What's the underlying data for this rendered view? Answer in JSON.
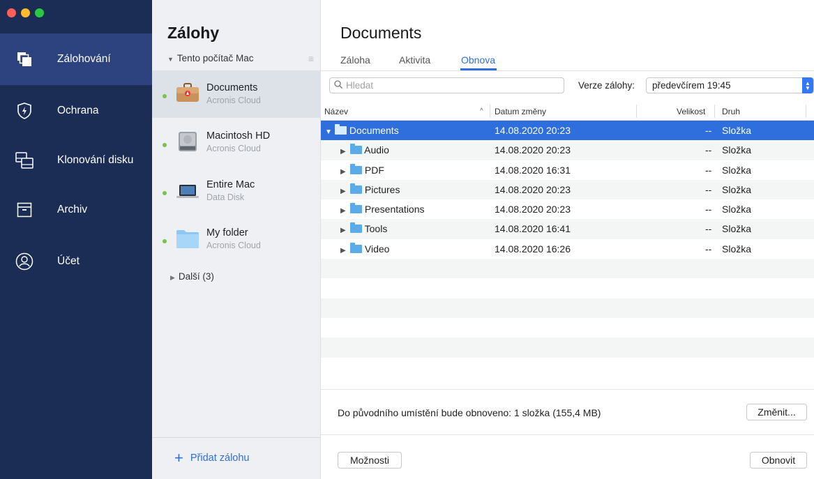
{
  "nav": {
    "items": [
      {
        "label": "Zálohování",
        "icon": "backup-icon",
        "active": true
      },
      {
        "label": "Ochrana",
        "icon": "shield-icon",
        "active": false
      },
      {
        "label": "Klonování disku",
        "icon": "clone-disk-icon",
        "active": false
      },
      {
        "label": "Archiv",
        "icon": "archive-icon",
        "active": false
      },
      {
        "label": "Účet",
        "icon": "account-icon",
        "active": false
      }
    ]
  },
  "backups": {
    "title": "Zálohy",
    "group": "Tento počítač Mac",
    "items": [
      {
        "name": "Documents",
        "location": "Acronis Cloud",
        "icon": "briefcase-icon",
        "status_color": "#7cc14a"
      },
      {
        "name": "Macintosh HD",
        "location": "Acronis Cloud",
        "icon": "hard-drive-icon",
        "status_color": "#7cc14a"
      },
      {
        "name": "Entire Mac",
        "location": "Data Disk",
        "icon": "laptop-icon",
        "status_color": "#7cc14a"
      },
      {
        "name": "My folder",
        "location": "Acronis Cloud",
        "icon": "folder-icon",
        "status_color": "#7cc14a"
      }
    ],
    "more": "Další (3)",
    "add_label": "Přidat zálohu"
  },
  "main": {
    "title": "Documents",
    "tabs": [
      {
        "label": "Záloha",
        "active": false
      },
      {
        "label": "Aktivita",
        "active": false
      },
      {
        "label": "Obnova",
        "active": true
      }
    ],
    "search_placeholder": "Hledat",
    "version_label": "Verze zálohy:",
    "version_value": "předevčírem 19:45",
    "columns": {
      "name": "Název",
      "date": "Datum změny",
      "size": "Velikost",
      "kind": "Druh"
    },
    "rows": [
      {
        "name": "Documents",
        "date": "14.08.2020 20:23",
        "size": "--",
        "kind": "Složka",
        "expanded": true,
        "selected": true,
        "level": 0
      },
      {
        "name": "Audio",
        "date": "14.08.2020 20:23",
        "size": "--",
        "kind": "Složka",
        "expanded": false,
        "selected": false,
        "level": 1
      },
      {
        "name": "PDF",
        "date": "14.08.2020 16:31",
        "size": "--",
        "kind": "Složka",
        "expanded": false,
        "selected": false,
        "level": 1
      },
      {
        "name": "Pictures",
        "date": "14.08.2020 20:23",
        "size": "--",
        "kind": "Složka",
        "expanded": false,
        "selected": false,
        "level": 1
      },
      {
        "name": "Presentations",
        "date": "14.08.2020 20:23",
        "size": "--",
        "kind": "Složka",
        "expanded": false,
        "selected": false,
        "level": 1
      },
      {
        "name": "Tools",
        "date": "14.08.2020 16:41",
        "size": "--",
        "kind": "Složka",
        "expanded": false,
        "selected": false,
        "level": 1
      },
      {
        "name": "Video",
        "date": "14.08.2020 16:26",
        "size": "--",
        "kind": "Složka",
        "expanded": false,
        "selected": false,
        "level": 1
      }
    ],
    "status": "Do původního umístění bude obnoveno: 1 složka (155,4 MB)",
    "change_button": "Změnit...",
    "options_button": "Možnosti",
    "restore_button": "Obnovit"
  },
  "colors": {
    "nav_bg": "#1c2d55",
    "nav_active": "#2c4380",
    "accent": "#2f6fdd",
    "status_ok": "#7cc14a",
    "traffic_close": "#fe5f57",
    "traffic_min": "#febc2e",
    "traffic_max": "#28c840"
  }
}
